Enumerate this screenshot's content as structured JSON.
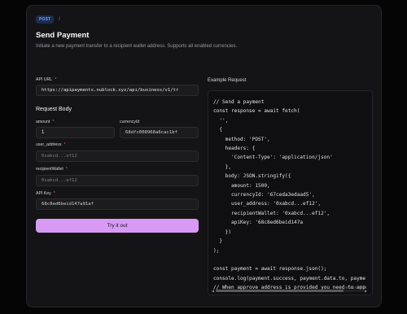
{
  "header": {
    "method": "POST",
    "separator": "/"
  },
  "title": "Send Payment",
  "description": "Initiate a new payment transfer to a recipient wallet address. Supports all enabled currencies.",
  "api_url": {
    "label": "API URL",
    "required_mark": "*",
    "value": "https://apipayments.nublock.xyz/api/business/v1/tr"
  },
  "request_body": {
    "heading": "Request Body",
    "amount": {
      "label": "amount",
      "required_mark": "*",
      "value": "1"
    },
    "currencyId": {
      "label": "currencyId",
      "value": "68dfc008968a6cac1bf"
    },
    "user_address": {
      "label": "user_address",
      "required_mark": "*",
      "placeholder": "0xabcd...ef12"
    },
    "recipientWallet": {
      "label": "recipientWallet",
      "required_mark": "*",
      "placeholder": "0xabcd...ef12"
    }
  },
  "api_key": {
    "label": "API Key",
    "required_mark": "*",
    "value": "68c8ed6beid147a91af"
  },
  "try_button": "Try it out",
  "example": {
    "label": "Example Request",
    "language": "javascript",
    "code_lines": [
      "// Send a payment",
      "const response = await fetch(",
      "  '',",
      "  {",
      "    method: 'POST',",
      "    headers: {",
      "      'Content-Type': 'application/json'",
      "    },",
      "    body: JSON.stringify({",
      "      amount: 1500,",
      "      currencyId: '67ceda3edaad5',",
      "      user_address: '0xabcd...ef12',",
      "      recipientWallet: '0xabcd...ef12',",
      "      apiKey: '68c8ed6beid147a",
      "    })",
      "  }",
      ");",
      "",
      "const payment = await response.json();",
      "console.log(payment.success, payment.data.to, payme",
      "// When approve address is provided you need to app"
    ]
  }
}
